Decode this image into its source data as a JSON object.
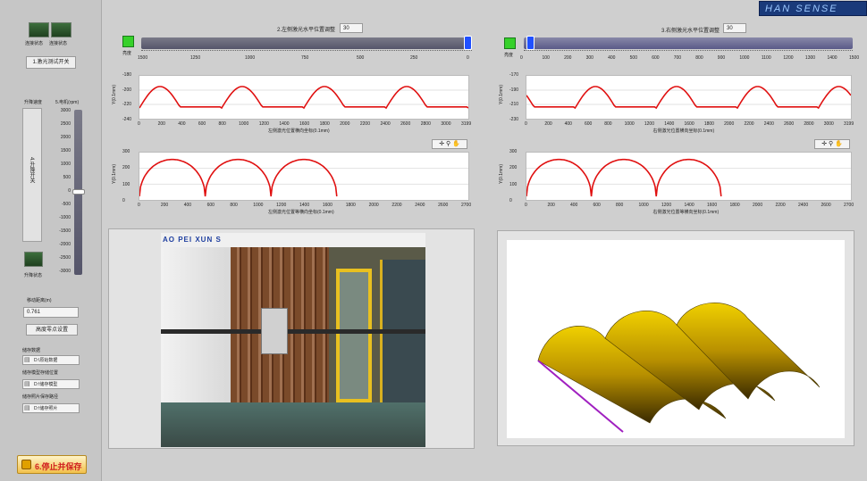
{
  "brand": "HAN SENSE",
  "left_panel": {
    "indicator_labels": [
      "连接状态",
      "连接状态"
    ],
    "laser_test_button": "1.激光测试开关",
    "lift_speed_label": "升降速度",
    "speed_label": "5.电机(rpm)",
    "speed_ticks": [
      "3000",
      "2500",
      "2000",
      "1500",
      "1000",
      "500",
      "0",
      "-500",
      "-1000",
      "-1500",
      "-2000",
      "-2500",
      "-3000"
    ],
    "lift_switch_button": "4.升降开关",
    "lift_limit_label": "升降状态",
    "lift_distance_label": "移动距离(m)",
    "lift_distance_value": "0.761",
    "set_zero_button": "高度零点设置",
    "save_data_label": "储存数据",
    "save_path_1": "D:\\原始数据",
    "save_photo_label": "储存模型存储位置",
    "save_path_2": "D:\\储存模型",
    "save_image_label": "储存照片保存路径",
    "save_path_3": "D:\\储存照片",
    "stop_save_button": "6.停止并保存"
  },
  "left_sensor": {
    "title": "2.左侧激光水平位置调整",
    "value": "30",
    "led_label": "亮度",
    "ticks": [
      "1500",
      "1250",
      "1000",
      "750",
      "500",
      "250",
      "0"
    ],
    "slider_fraction": 0.0,
    "plot1": {
      "ylabel": "Y(0.1mm)",
      "yticks": [
        "-180",
        "-200",
        "-220",
        "-240"
      ],
      "xticks": [
        "0",
        "200",
        "400",
        "600",
        "800",
        "1000",
        "1200",
        "1400",
        "1600",
        "1800",
        "2000",
        "2200",
        "2400",
        "2600",
        "2800",
        "3000",
        "3199"
      ],
      "xlabel": "左侧激光位置横向坐标(0.1mm)"
    },
    "plot2": {
      "ylabel": "Y(0.1mm)",
      "yticks": [
        "300",
        "200",
        "100",
        "0"
      ],
      "xticks": [
        "0",
        "200",
        "400",
        "600",
        "800",
        "1000",
        "1200",
        "1400",
        "1600",
        "1800",
        "2000",
        "2200",
        "2400",
        "2600",
        "2700"
      ],
      "xlabel": "左侧激光位置等横向坐标(0.1mm)"
    }
  },
  "right_sensor": {
    "title": "3.右侧激光水平位置调整",
    "value": "30",
    "led_label": "亮度",
    "ticks": [
      "0",
      "100",
      "200",
      "300",
      "400",
      "500",
      "600",
      "700",
      "800",
      "900",
      "1000",
      "1100",
      "1200",
      "1300",
      "1400",
      "1500"
    ],
    "slider_fraction": 0.0,
    "plot1": {
      "ylabel": "Y(0.1mm)",
      "yticks": [
        "-170",
        "-190",
        "-210",
        "-230"
      ],
      "xticks": [
        "0",
        "200",
        "400",
        "600",
        "800",
        "1000",
        "1200",
        "1400",
        "1600",
        "1800",
        "2000",
        "2200",
        "2400",
        "2600",
        "2800",
        "3000",
        "3199"
      ],
      "xlabel": "右侧激光位置横向坐标(0.1mm)"
    },
    "plot2": {
      "ylabel": "Y(0.1mm)",
      "yticks": [
        "300",
        "200",
        "100",
        "0"
      ],
      "xticks": [
        "0",
        "200",
        "400",
        "600",
        "800",
        "1000",
        "1200",
        "1400",
        "1600",
        "1800",
        "2000",
        "2200",
        "2400",
        "2600",
        "2700"
      ],
      "xlabel": "右侧激光位置等横向坐标(0.1mm)"
    }
  },
  "camera": {
    "sign_text": "AO PEI XUN S"
  },
  "colors": {
    "trace": "#e01010",
    "bg": "#cfcfcf",
    "led_green": "#36d12a",
    "slider_blue": "#2050ff"
  }
}
